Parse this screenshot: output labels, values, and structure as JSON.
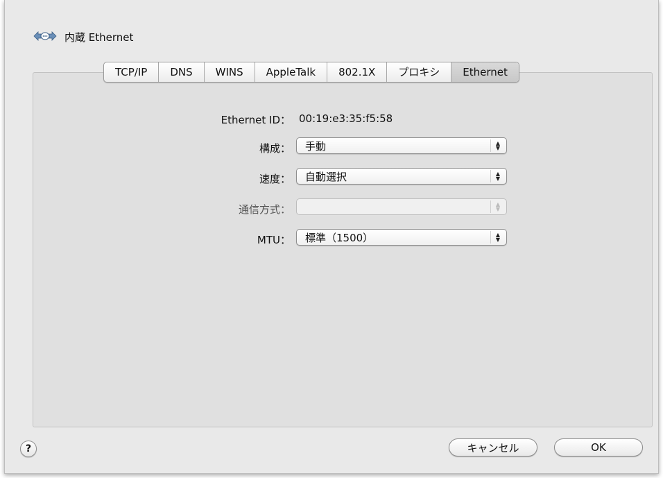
{
  "header": {
    "title": "内蔵 Ethernet",
    "icon": "ethernet-icon"
  },
  "tabs": [
    {
      "label": "TCP/IP",
      "active": false
    },
    {
      "label": "DNS",
      "active": false
    },
    {
      "label": "WINS",
      "active": false
    },
    {
      "label": "AppleTalk",
      "active": false
    },
    {
      "label": "802.1X",
      "active": false
    },
    {
      "label": "プロキシ",
      "active": false
    },
    {
      "label": "Ethernet",
      "active": true
    }
  ],
  "form": {
    "ethernet_id_label": "Ethernet ID：",
    "ethernet_id_value": "00:19:e3:35:f5:58",
    "config_label": "構成：",
    "config_value": "手動",
    "speed_label": "速度：",
    "speed_value": "自動選択",
    "duplex_label": "通信方式：",
    "duplex_value": "",
    "mtu_label": "MTU：",
    "mtu_value": "標準（1500）"
  },
  "footer": {
    "help_label": "?",
    "cancel_label": "キャンセル",
    "ok_label": "OK"
  }
}
